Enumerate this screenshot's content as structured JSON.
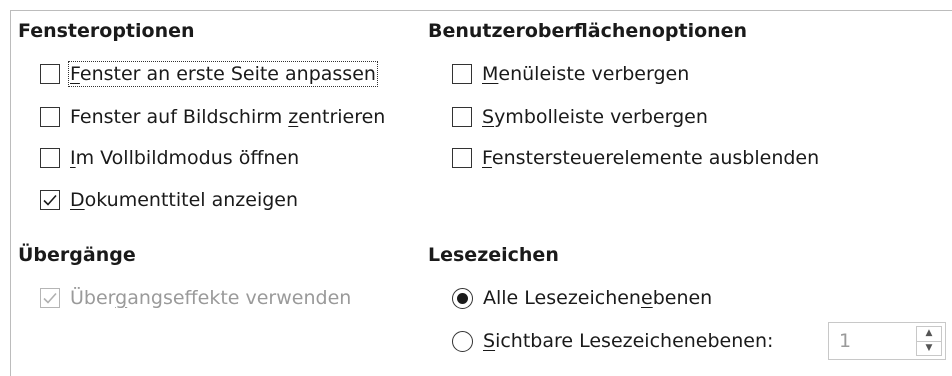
{
  "window_options": {
    "heading": "Fensteroptionen",
    "items": [
      {
        "pre": "",
        "mnemonic": "F",
        "post": "enster an erste Seite anpassen",
        "checked": false
      },
      {
        "pre": "Fenster auf Bildschirm ",
        "mnemonic": "z",
        "post": "entrieren",
        "checked": false
      },
      {
        "pre": "",
        "mnemonic": "I",
        "post": "m Vollbildmodus öffnen",
        "checked": false
      },
      {
        "pre": "",
        "mnemonic": "D",
        "post": "okumenttitel anzeigen",
        "checked": true
      }
    ]
  },
  "ui_options": {
    "heading": "Benutzeroberflächenoptionen",
    "items": [
      {
        "pre": "",
        "mnemonic": "M",
        "post": "enüleiste verbergen",
        "checked": false
      },
      {
        "pre": "",
        "mnemonic": "S",
        "post": "ymbolleiste verbergen",
        "checked": false
      },
      {
        "pre": "",
        "mnemonic": "F",
        "post": "enstersteuerelemente ausblenden",
        "checked": false
      }
    ]
  },
  "transitions": {
    "heading": "Übergänge",
    "item": {
      "pre": "Über",
      "mnemonic": "g",
      "post": "angseffekte verwenden",
      "checked": true,
      "disabled": true
    }
  },
  "bookmarks": {
    "heading": "Lesezeichen",
    "radio_all": {
      "pre": "Alle Lesezeichen",
      "mnemonic": "e",
      "post": "benen",
      "selected": true
    },
    "radio_visible": {
      "pre": "",
      "mnemonic": "S",
      "post": "ichtbare Lesezeichenebenen:",
      "selected": false
    },
    "levels_value": "1"
  }
}
